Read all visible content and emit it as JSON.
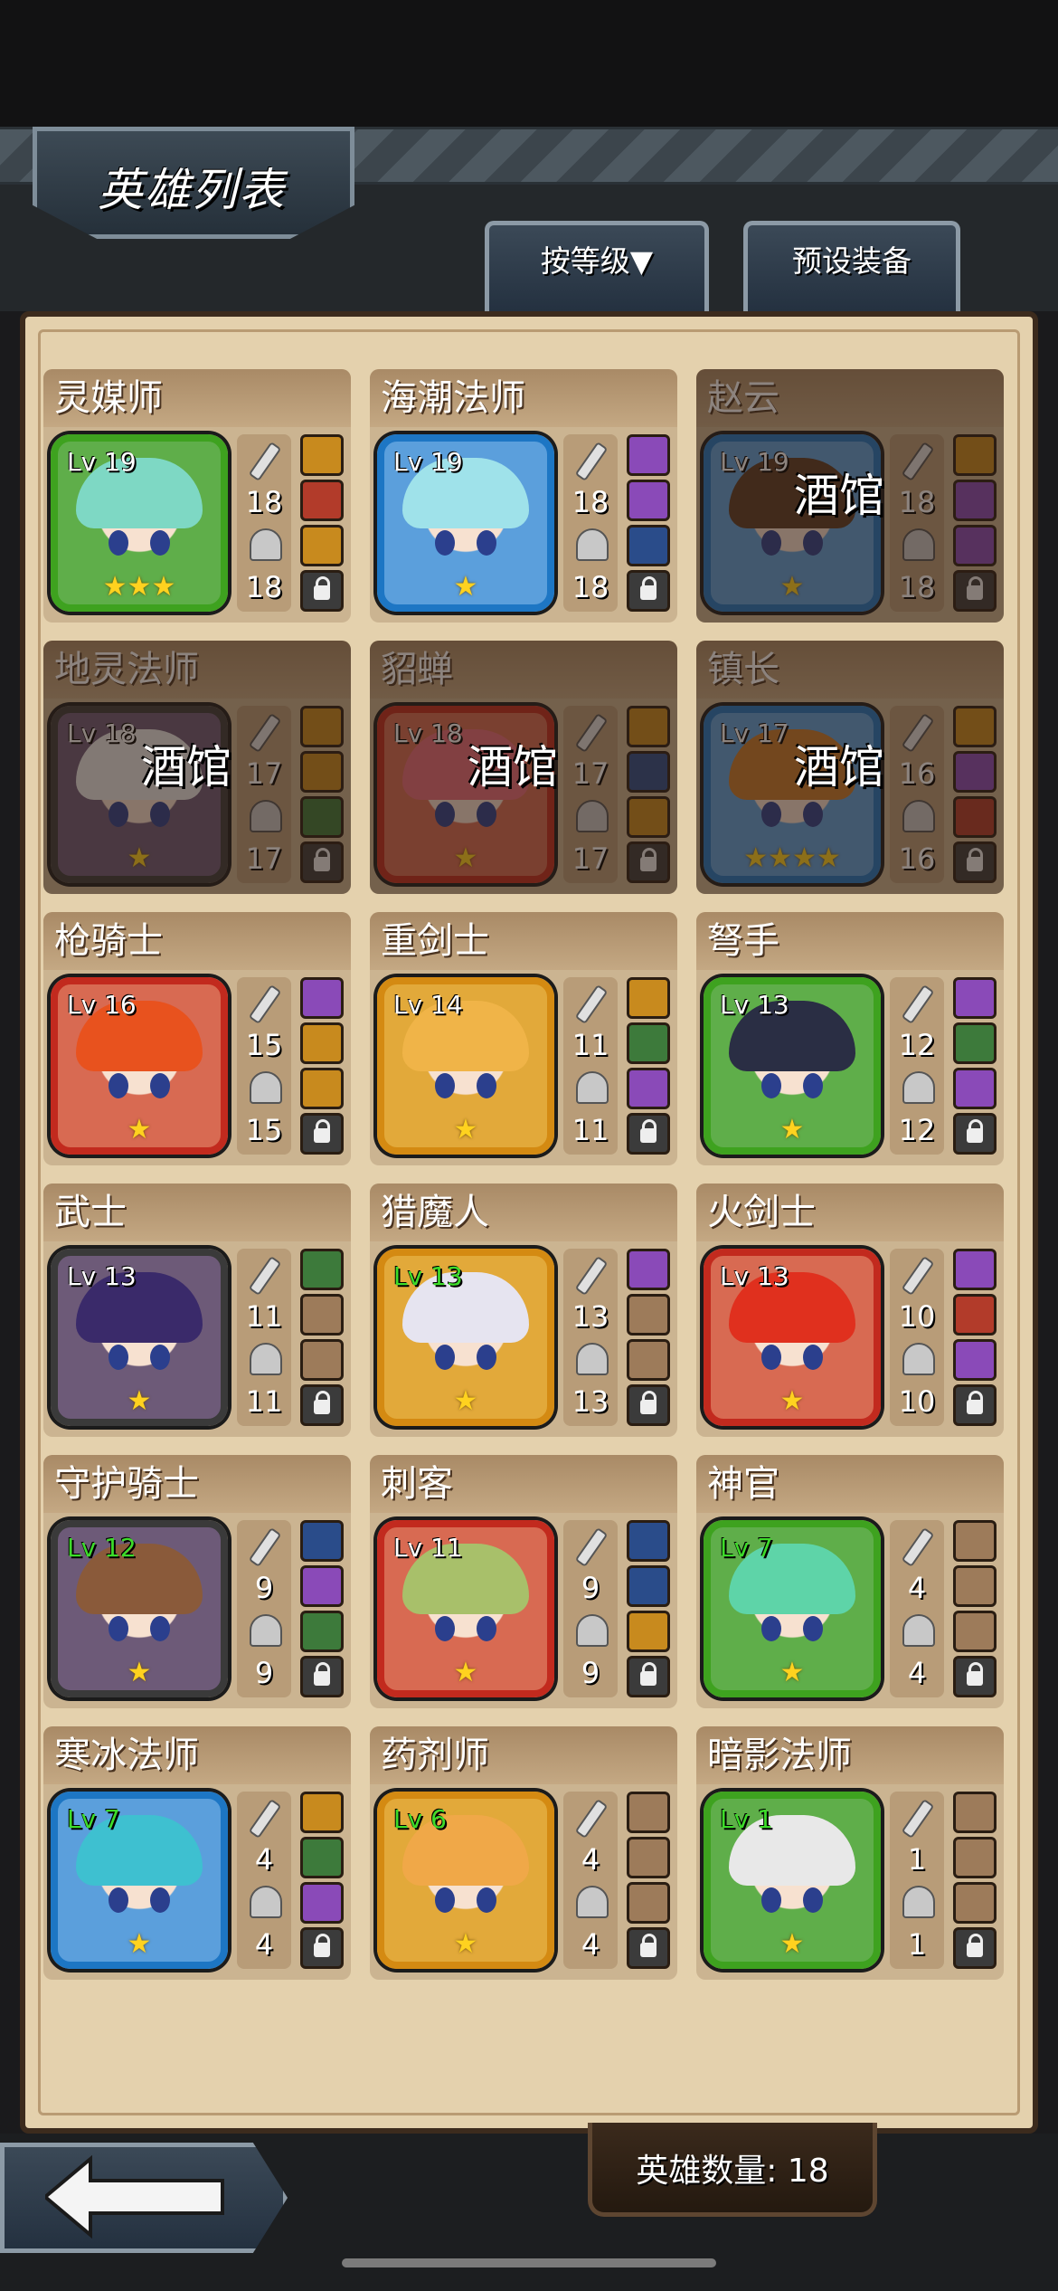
{
  "header": {
    "title": "英雄列表"
  },
  "tabs": {
    "sort_label": "按等级▼",
    "preset_label": "预设装备"
  },
  "footer": {
    "hero_count_label": "英雄数量: 18"
  },
  "heroes": [
    {
      "name": "灵媒师",
      "level": "Lv 19",
      "stars": "★★★",
      "attack": "18",
      "defense": "18",
      "tavern": "",
      "rarity": "green",
      "hair": "#7ed8c4",
      "slots": [
        "o",
        "r",
        "o"
      ],
      "dim": false,
      "lv_green": false
    },
    {
      "name": "海潮法师",
      "level": "Lv 19",
      "stars": "★",
      "attack": "18",
      "defense": "18",
      "tavern": "",
      "rarity": "blue",
      "hair": "#9fe2ea",
      "slots": [
        "filled",
        "filled",
        "b"
      ],
      "dim": false,
      "lv_green": false
    },
    {
      "name": "赵云",
      "level": "Lv 19",
      "stars": "★",
      "attack": "18",
      "defense": "18",
      "tavern": "酒馆",
      "rarity": "blue",
      "hair": "#5a3a24",
      "slots": [
        "o",
        "filled",
        "filled"
      ],
      "dim": true,
      "lv_green": false
    },
    {
      "name": "地灵法师",
      "level": "Lv 18",
      "stars": "★",
      "attack": "17",
      "defense": "17",
      "tavern": "酒馆",
      "rarity": "dark",
      "hair": "#e8e8e8",
      "slots": [
        "o",
        "o",
        "g"
      ],
      "dim": true,
      "lv_green": false
    },
    {
      "name": "貂蝉",
      "level": "Lv 18",
      "stars": "★",
      "attack": "17",
      "defense": "17",
      "tavern": "酒馆",
      "rarity": "red",
      "hair": "#e86a7a",
      "slots": [
        "o",
        "b",
        "o"
      ],
      "dim": true,
      "lv_green": false
    },
    {
      "name": "镇长",
      "level": "Lv 17",
      "stars": "★★★★",
      "attack": "16",
      "defense": "16",
      "tavern": "酒馆",
      "rarity": "blue",
      "hair": "#c87a2a",
      "slots": [
        "o",
        "filled",
        "r"
      ],
      "dim": true,
      "lv_green": false
    },
    {
      "name": "枪骑士",
      "level": "Lv 16",
      "stars": "★",
      "attack": "15",
      "defense": "15",
      "tavern": "",
      "rarity": "red",
      "hair": "#e8521e",
      "slots": [
        "filled",
        "o",
        "o"
      ],
      "dim": false,
      "lv_green": false
    },
    {
      "name": "重剑士",
      "level": "Lv 14",
      "stars": "★",
      "attack": "11",
      "defense": "11",
      "tavern": "",
      "rarity": "orange",
      "hair": "#f0b448",
      "slots": [
        "o",
        "g",
        "filled"
      ],
      "dim": false,
      "lv_green": false
    },
    {
      "name": "弩手",
      "level": "Lv 13",
      "stars": "★",
      "attack": "12",
      "defense": "12",
      "tavern": "",
      "rarity": "green",
      "hair": "#2a2e44",
      "slots": [
        "filled",
        "g",
        "filled"
      ],
      "dim": false,
      "lv_green": false
    },
    {
      "name": "武士",
      "level": "Lv 13",
      "stars": "★",
      "attack": "11",
      "defense": "11",
      "tavern": "",
      "rarity": "dark",
      "hair": "#3a2a6a",
      "slots": [
        "g",
        "",
        ""
      ],
      "dim": false,
      "lv_green": false
    },
    {
      "name": "猎魔人",
      "level": "Lv 13",
      "stars": "★",
      "attack": "13",
      "defense": "13",
      "tavern": "",
      "rarity": "orange",
      "hair": "#e6e4f0",
      "slots": [
        "filled",
        "",
        ""
      ],
      "dim": false,
      "lv_green": true
    },
    {
      "name": "火剑士",
      "level": "Lv 13",
      "stars": "★",
      "attack": "10",
      "defense": "10",
      "tavern": "",
      "rarity": "red",
      "hair": "#e0301e",
      "slots": [
        "filled",
        "r",
        "filled"
      ],
      "dim": false,
      "lv_green": false
    },
    {
      "name": "守护骑士",
      "level": "Lv 12",
      "stars": "★",
      "attack": "9",
      "defense": "9",
      "tavern": "",
      "rarity": "dark",
      "hair": "#8a5a3a",
      "slots": [
        "b",
        "filled",
        "g"
      ],
      "dim": false,
      "lv_green": true
    },
    {
      "name": "刺客",
      "level": "Lv 11",
      "stars": "★",
      "attack": "9",
      "defense": "9",
      "tavern": "",
      "rarity": "red",
      "hair": "#a8c06a",
      "slots": [
        "b",
        "b",
        "o"
      ],
      "dim": false,
      "lv_green": false
    },
    {
      "name": "神官",
      "level": "Lv 7",
      "stars": "★",
      "attack": "4",
      "defense": "4",
      "tavern": "",
      "rarity": "green",
      "hair": "#5ed4a8",
      "slots": [
        "",
        "",
        ""
      ],
      "dim": false,
      "lv_green": true
    },
    {
      "name": "寒冰法师",
      "level": "Lv 7",
      "stars": "★",
      "attack": "4",
      "defense": "4",
      "tavern": "",
      "rarity": "blue",
      "hair": "#3ec0d0",
      "slots": [
        "o",
        "g",
        "filled"
      ],
      "dim": false,
      "lv_green": true
    },
    {
      "name": "药剂师",
      "level": "Lv 6",
      "stars": "★",
      "attack": "4",
      "defense": "4",
      "tavern": "",
      "rarity": "orange",
      "hair": "#f0a848",
      "slots": [
        "",
        "",
        ""
      ],
      "dim": false,
      "lv_green": true
    },
    {
      "name": "暗影法师",
      "level": "Lv 1",
      "stars": "★",
      "attack": "1",
      "defense": "1",
      "tavern": "",
      "rarity": "green",
      "hair": "#e8e8e8",
      "slots": [
        "",
        "",
        ""
      ],
      "dim": false,
      "lv_green": true
    }
  ]
}
